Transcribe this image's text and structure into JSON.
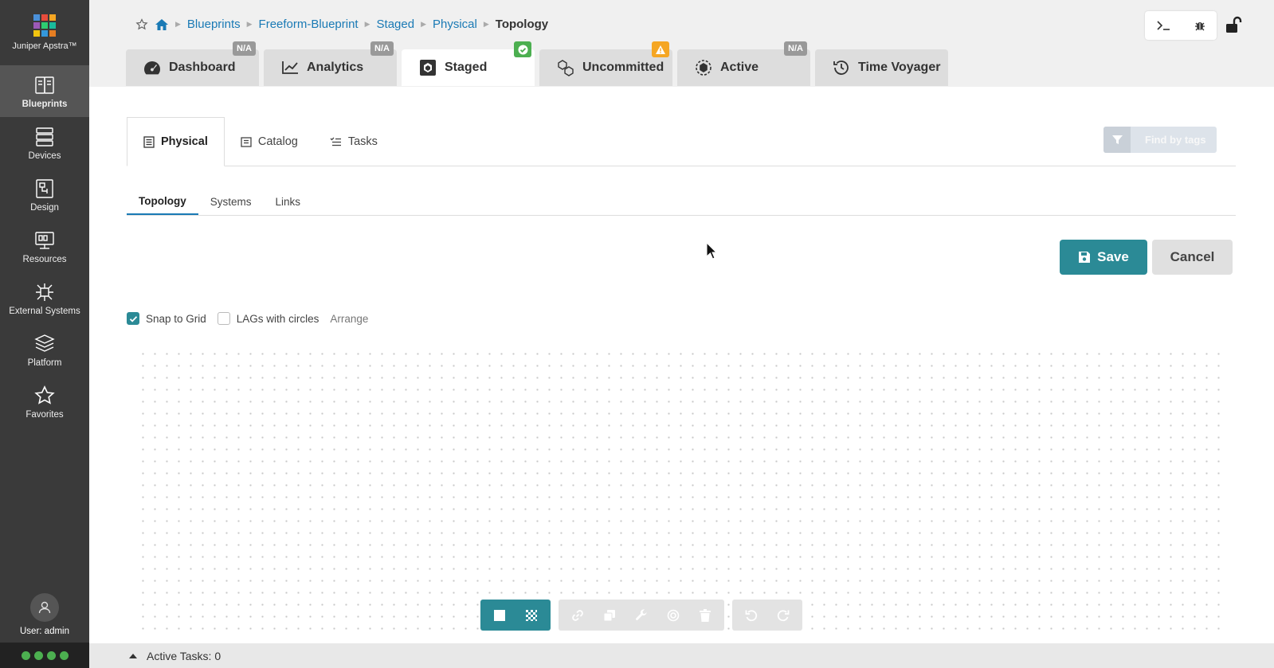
{
  "app": {
    "name": "Juniper Apstra™"
  },
  "sidebar": {
    "items": [
      {
        "label": "Blueprints",
        "icon": "blueprints-icon",
        "active": true
      },
      {
        "label": "Devices",
        "icon": "devices-icon"
      },
      {
        "label": "Design",
        "icon": "design-icon"
      },
      {
        "label": "Resources",
        "icon": "resources-icon"
      },
      {
        "label": "External Systems",
        "icon": "external-systems-icon"
      },
      {
        "label": "Platform",
        "icon": "platform-icon"
      },
      {
        "label": "Favorites",
        "icon": "star-icon"
      }
    ],
    "user_label": "User: admin"
  },
  "breadcrumb": {
    "items": [
      "Blueprints",
      "Freeform-Blueprint",
      "Staged",
      "Physical"
    ],
    "current": "Topology"
  },
  "tabs": [
    {
      "label": "Dashboard",
      "badge": "N/A"
    },
    {
      "label": "Analytics",
      "badge": "N/A"
    },
    {
      "label": "Staged",
      "badge": "",
      "active": true
    },
    {
      "label": "Uncommitted",
      "badge": ""
    },
    {
      "label": "Active",
      "badge": "N/A"
    },
    {
      "label": "Time Voyager",
      "badge": ""
    }
  ],
  "subtabs": [
    {
      "label": "Physical",
      "active": true
    },
    {
      "label": "Catalog"
    },
    {
      "label": "Tasks"
    }
  ],
  "find_by_tags": "Find by tags",
  "viewtabs": [
    {
      "label": "Topology",
      "active": true
    },
    {
      "label": "Systems"
    },
    {
      "label": "Links"
    }
  ],
  "actions": {
    "save": "Save",
    "cancel": "Cancel"
  },
  "options": {
    "snap_to_grid": {
      "label": "Snap to Grid",
      "checked": true
    },
    "lags_with_circles": {
      "label": "LAGs with circles",
      "checked": false
    },
    "arrange": "Arrange"
  },
  "status": {
    "active_tasks": "Active Tasks: 0"
  },
  "colors": {
    "accent": "#2b8a96",
    "link": "#1a7ab5",
    "sidebar": "#3a3a3a",
    "ok": "#4caf50",
    "warn": "#f5a623"
  }
}
